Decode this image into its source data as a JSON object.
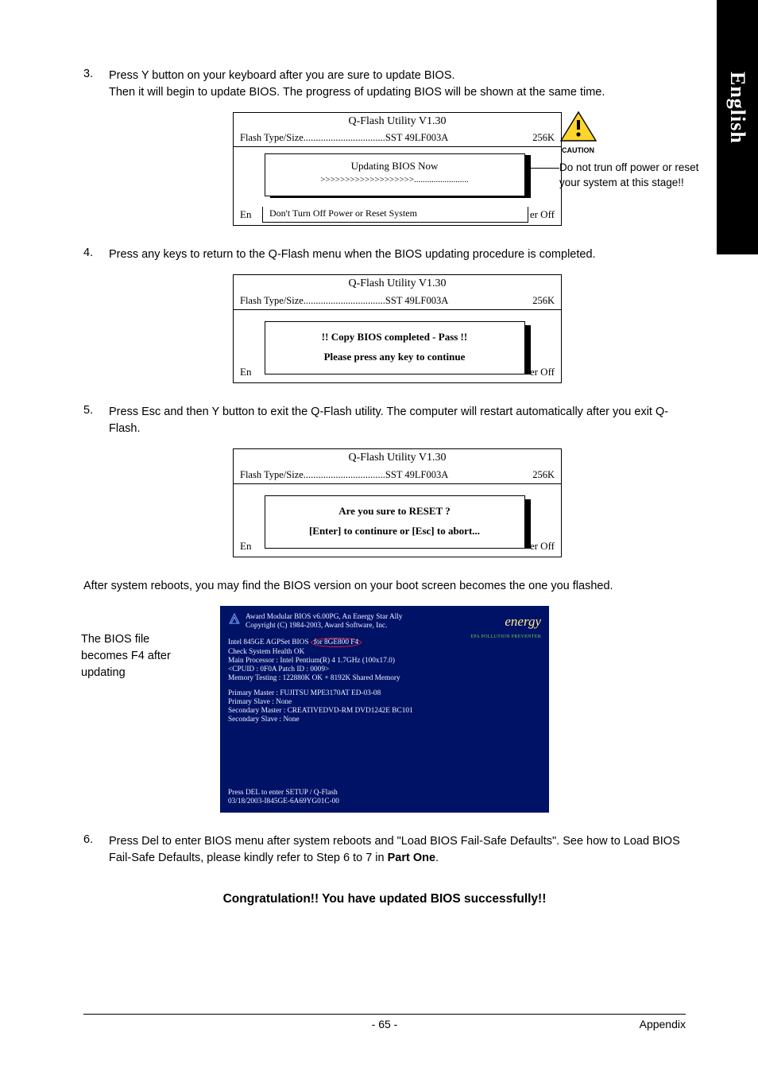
{
  "sideTab": "English",
  "steps": {
    "s3": {
      "num": "3.",
      "text1": "Press Y button on your keyboard after you are sure to update BIOS.",
      "text2": "Then it will begin to update BIOS. The progress of updating BIOS will be shown at the same time."
    },
    "s4": {
      "num": "4.",
      "text": "Press any keys to return to the Q-Flash menu when the BIOS updating procedure is completed."
    },
    "s5": {
      "num": "5.",
      "text": "Press Esc and then Y button to exit the Q-Flash utility. The computer will restart automatically after you exit Q-Flash."
    },
    "s6": {
      "num": "6.",
      "text": "Press Del to enter BIOS menu after system reboots and \"Load BIOS Fail-Safe Defaults\". See how to Load BIOS Fail-Safe Defaults, please kindly refer to Step 6 to 7 in Part One."
    }
  },
  "qflash": {
    "title": "Q-Flash Utility V1.30",
    "metaLeft": "Flash Type/Size.................................SST 49LF003A",
    "metaRight": "256K",
    "lowLeft1": "En",
    "lowRight1": "er Off",
    "lowLeft2": "En",
    "lowRight2": "er Off",
    "lowLeft3": "En",
    "lowRight3": "er Off",
    "lowOverlay": "Don't Turn Off Power or Reset System",
    "box1line1": "Updating BIOS Now",
    "box1line2": ">>>>>>>>>>>>>>>>>>>.........................",
    "box2line1": "!! Copy BIOS completed - Pass !!",
    "box2line2": "Please press any key to continue",
    "box3line1": "Are you sure to RESET ?",
    "box3line2": "[Enter] to continure or [Esc] to abort..."
  },
  "caution": {
    "label": "CAUTION",
    "text": "Do not trun off power or reset your system at this stage!!"
  },
  "afterReboot": "After system reboots, you may find the BIOS version on your boot screen becomes the one you flashed.",
  "caption": "The BIOS file becomes F4 after updating",
  "boot": {
    "head1": "Award Modular BIOS v6.00PG, An Energy Star Ally",
    "head2": "Copyright  (C)  1984-2003, Award Software,   Inc.",
    "l1a": "Intel 845GE AGPSet BIOS ",
    "l1oval": "for 8GE800 F4",
    "l2": "Check System Health OK",
    "l3": "Main Processor : Intel Pentium(R) 4   1.7GHz  (100x17.0)",
    "l4": "<CPUID : 0F0A Patch ID   : 0009>",
    "l5": "Memory Testing   :  122880K OK + 8192K Shared Memory",
    "l6": "Primary Master : FUJITSU MPE3170AT ED-03-08",
    "l7": "Primary Slave : None",
    "l8": "Secondary Master : CREATIVEDVD-RM DVD1242E BC101",
    "l9": "Secondary Slave : None",
    "f1": "Press DEL to enter SETUP / Q-Flash",
    "f2": "03/18/2003-I845GE-6A69YG01C-00",
    "logoText": "energy",
    "logoSub": "EPA  POLLUTION PREVENTER"
  },
  "congrats": "Congratulation!! You have updated BIOS successfully!!",
  "footer": {
    "center": "- 65 -",
    "right": "Appendix"
  }
}
